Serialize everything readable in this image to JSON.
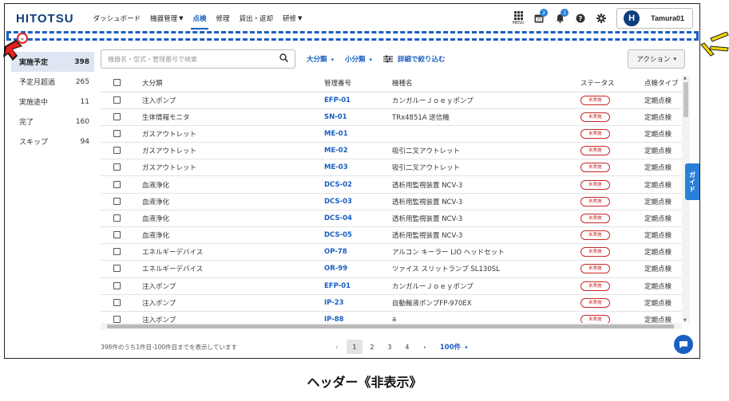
{
  "header": {
    "logo": "HITOTSU",
    "nav": [
      {
        "label": "ダッシュボード",
        "caret": false,
        "active": false
      },
      {
        "label": "機器管理",
        "caret": true,
        "active": false
      },
      {
        "label": "点検",
        "caret": false,
        "active": true
      },
      {
        "label": "修理",
        "caret": false,
        "active": false
      },
      {
        "label": "貸出・返却",
        "caret": false,
        "active": false
      },
      {
        "label": "研修",
        "caret": true,
        "active": false
      }
    ],
    "menu_label": "MENU",
    "calendar_badge": "2",
    "bell_badge": "1",
    "user_initial": "H",
    "user_name": "Tamura01"
  },
  "sidebar": {
    "items": [
      {
        "label": "実施予定",
        "count": "398",
        "active": true
      },
      {
        "label": "予定月超過",
        "count": "265",
        "active": false
      },
      {
        "label": "実施途中",
        "count": "11",
        "active": false
      },
      {
        "label": "完了",
        "count": "160",
        "active": false
      },
      {
        "label": "スキップ",
        "count": "94",
        "active": false
      }
    ]
  },
  "toolbar": {
    "search_placeholder": "機器名・型式・管理番号で検索",
    "major_category": "大分類",
    "minor_category": "小分類",
    "detail_filter": "詳細で絞り込む",
    "action": "アクション"
  },
  "table": {
    "columns": [
      "大分類",
      "管理番号",
      "機種名",
      "ステータス",
      "点検タイプ"
    ],
    "rows": [
      {
        "category": "注入ポンプ",
        "code": "EFP-01",
        "model": "カンガルーＪｏｅｙポンプ",
        "status": "未実施",
        "type": "定期点検"
      },
      {
        "category": "生体情報モニタ",
        "code": "SN-01",
        "model": "TRx4851A 送信機",
        "status": "未実施",
        "type": "定期点検"
      },
      {
        "category": "ガスアウトレット",
        "code": "ME-01",
        "model": "",
        "status": "未実施",
        "type": "定期点検"
      },
      {
        "category": "ガスアウトレット",
        "code": "ME-02",
        "model": "吸引二叉アウトレット",
        "status": "未実施",
        "type": "定期点検"
      },
      {
        "category": "ガスアウトレット",
        "code": "ME-03",
        "model": "吸引二叉アウトレット",
        "status": "未実施",
        "type": "定期点検"
      },
      {
        "category": "血液浄化",
        "code": "DCS-02",
        "model": "透析用監視装置 NCV-3",
        "status": "未実施",
        "type": "定期点検"
      },
      {
        "category": "血液浄化",
        "code": "DCS-03",
        "model": "透析用監視装置 NCV-3",
        "status": "未実施",
        "type": "定期点検"
      },
      {
        "category": "血液浄化",
        "code": "DCS-04",
        "model": "透析用監視装置 NCV-3",
        "status": "未実施",
        "type": "定期点検"
      },
      {
        "category": "血液浄化",
        "code": "DCS-05",
        "model": "透析用監視装置 NCV-3",
        "status": "未実施",
        "type": "定期点検"
      },
      {
        "category": "エネルギーデバイス",
        "code": "OP-78",
        "model": "アルコン キーラー LIO ヘッドセット",
        "status": "未実施",
        "type": "定期点検"
      },
      {
        "category": "エネルギーデバイス",
        "code": "OR-99",
        "model": "ツァイス スリットランプ SL130SL",
        "status": "未実施",
        "type": "定期点検"
      },
      {
        "category": "注入ポンプ",
        "code": "EFP-01",
        "model": "カンガルーＪｏｅｙポンプ",
        "status": "未実施",
        "type": "定期点検"
      },
      {
        "category": "注入ポンプ",
        "code": "IP-23",
        "model": "自動輸液ポンプFP-970EX",
        "status": "未実施",
        "type": "定期点検"
      },
      {
        "category": "注入ポンプ",
        "code": "IP-88",
        "model": "a",
        "status": "未実施",
        "type": "定期点検"
      }
    ]
  },
  "footer": {
    "range_text": "398件のうち1件目-100件目までを表示しています",
    "pages": [
      "1",
      "2",
      "3",
      "4"
    ],
    "current_page": "1",
    "per_page": "100件"
  },
  "guide_label": "ガイド",
  "caption": "ヘッダー《非表示》",
  "colors": {
    "brand": "#0d3d7a",
    "accent": "#1a5fc0",
    "status": "#c62828",
    "highlight": "#e52020"
  }
}
